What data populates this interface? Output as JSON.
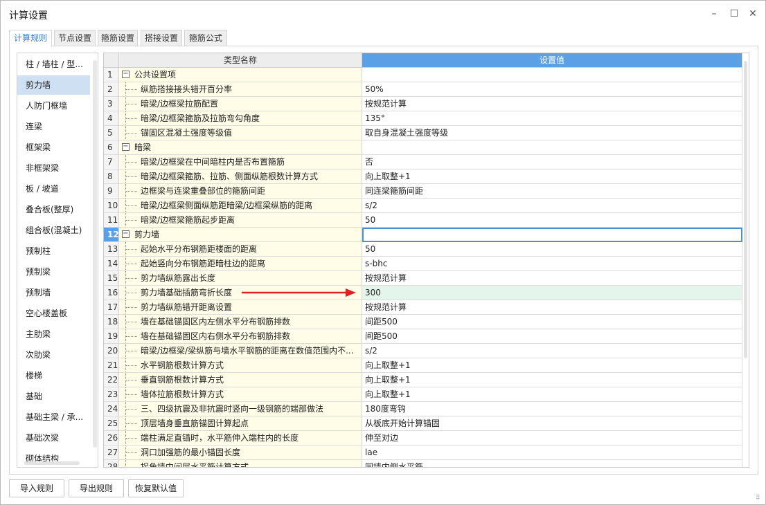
{
  "window": {
    "title": "计算设置",
    "controls": {
      "minimize": "–",
      "maximize": "☐",
      "close": "✕"
    }
  },
  "tabs": [
    {
      "label": "计算规则",
      "active": true
    },
    {
      "label": "节点设置",
      "active": false
    },
    {
      "label": "箍筋设置",
      "active": false
    },
    {
      "label": "搭接设置",
      "active": false
    },
    {
      "label": "箍筋公式",
      "active": false
    }
  ],
  "sidebar": {
    "items": [
      {
        "label": "柱 / 墙柱 / 型..."
      },
      {
        "label": "剪力墙",
        "selected": true
      },
      {
        "label": "人防门框墙"
      },
      {
        "label": "连梁"
      },
      {
        "label": "框架梁"
      },
      {
        "label": "非框架梁"
      },
      {
        "label": "板 / 坡道"
      },
      {
        "label": "叠合板(整厚)"
      },
      {
        "label": "组合板(混凝土)"
      },
      {
        "label": "预制柱"
      },
      {
        "label": "预制梁"
      },
      {
        "label": "预制墙"
      },
      {
        "label": "空心楼盖板"
      },
      {
        "label": "主肋梁"
      },
      {
        "label": "次肋梁"
      },
      {
        "label": "楼梯"
      },
      {
        "label": "基础"
      },
      {
        "label": "基础主梁 / 承..."
      },
      {
        "label": "基础次梁"
      },
      {
        "label": "砌体结构"
      }
    ]
  },
  "grid": {
    "headers": {
      "name": "类型名称",
      "value": "设置值"
    },
    "selected_row": "12",
    "rows": [
      {
        "num": "1",
        "group": true,
        "toggle": "−",
        "name": "公共设置项",
        "value": ""
      },
      {
        "num": "2",
        "name": "纵筋搭接接头错开百分率",
        "value": "50%"
      },
      {
        "num": "3",
        "name": "暗梁/边框梁拉筋配置",
        "value": "按规范计算"
      },
      {
        "num": "4",
        "name": "暗梁/边框梁箍筋及拉筋弯勾角度",
        "value": "135°"
      },
      {
        "num": "5",
        "name": "锚固区混凝土强度等级值",
        "value": "取自身混凝土强度等级"
      },
      {
        "num": "6",
        "group": true,
        "toggle": "−",
        "name": "暗梁",
        "value": ""
      },
      {
        "num": "7",
        "name": "暗梁/边框梁在中间暗柱内是否布置箍筋",
        "value": "否"
      },
      {
        "num": "8",
        "name": "暗梁/边框梁箍筋、拉筋、侧面纵筋根数计算方式",
        "value": "向上取整+1"
      },
      {
        "num": "9",
        "name": "边框梁与连梁重叠部位的箍筋间距",
        "value": "同连梁箍筋间距"
      },
      {
        "num": "10",
        "name": "暗梁/边框梁侧面纵筋距暗梁/边框梁纵筋的距离",
        "value": "s/2"
      },
      {
        "num": "11",
        "name": "暗梁/边框梁箍筋起步距离",
        "value": "50"
      },
      {
        "num": "12",
        "group": true,
        "toggle": "−",
        "name": "剪力墙",
        "value": "",
        "focus": true
      },
      {
        "num": "13",
        "name": "起始水平分布钢筋距楼面的距离",
        "value": "50"
      },
      {
        "num": "14",
        "name": "起始竖向分布钢筋距暗柱边的距离",
        "value": "s-bhc"
      },
      {
        "num": "15",
        "name": "剪力墙纵筋露出长度",
        "value": "按规范计算"
      },
      {
        "num": "16",
        "name": "剪力墙基础插筋弯折长度",
        "value": "300",
        "highlight": true
      },
      {
        "num": "17",
        "name": "剪力墙纵筋错开距离设置",
        "value": "按规范计算"
      },
      {
        "num": "18",
        "name": "墙在基础锚固区内左侧水平分布钢筋排数",
        "value": "间距500"
      },
      {
        "num": "19",
        "name": "墙在基础锚固区内右侧水平分布钢筋排数",
        "value": "间距500"
      },
      {
        "num": "20",
        "name": "暗梁/边框梁/梁纵筋与墙水平钢筋的距离在数值范围内不...",
        "value": "s/2"
      },
      {
        "num": "21",
        "name": "水平钢筋根数计算方式",
        "value": "向上取整+1"
      },
      {
        "num": "22",
        "name": "垂直钢筋根数计算方式",
        "value": "向上取整+1"
      },
      {
        "num": "23",
        "name": "墙体拉筋根数计算方式",
        "value": "向上取整+1"
      },
      {
        "num": "24",
        "name": "三、四级抗震及非抗震时竖向一级钢筋的端部做法",
        "value": "180度弯钩"
      },
      {
        "num": "25",
        "name": "顶层墙身垂直筋锚固计算起点",
        "value": "从板底开始计算锚固"
      },
      {
        "num": "26",
        "name": "端柱满足直锚时，水平筋伸入端柱内的长度",
        "value": "伸至对边"
      },
      {
        "num": "27",
        "name": "洞口加强筋的最小锚固长度",
        "value": "lae"
      },
      {
        "num": "28",
        "name": "拐角墙中间层水平筋计算方式",
        "value": "同墙内侧水平筋"
      }
    ]
  },
  "buttons": {
    "import": "导入规则",
    "export": "导出规则",
    "restore": "恢复默认值"
  },
  "colors": {
    "accent": "#5aa0e6",
    "name_cell_bg": "#fffde8",
    "highlight_row_bg": "#e4f5ec",
    "arrow": "#e02020"
  }
}
